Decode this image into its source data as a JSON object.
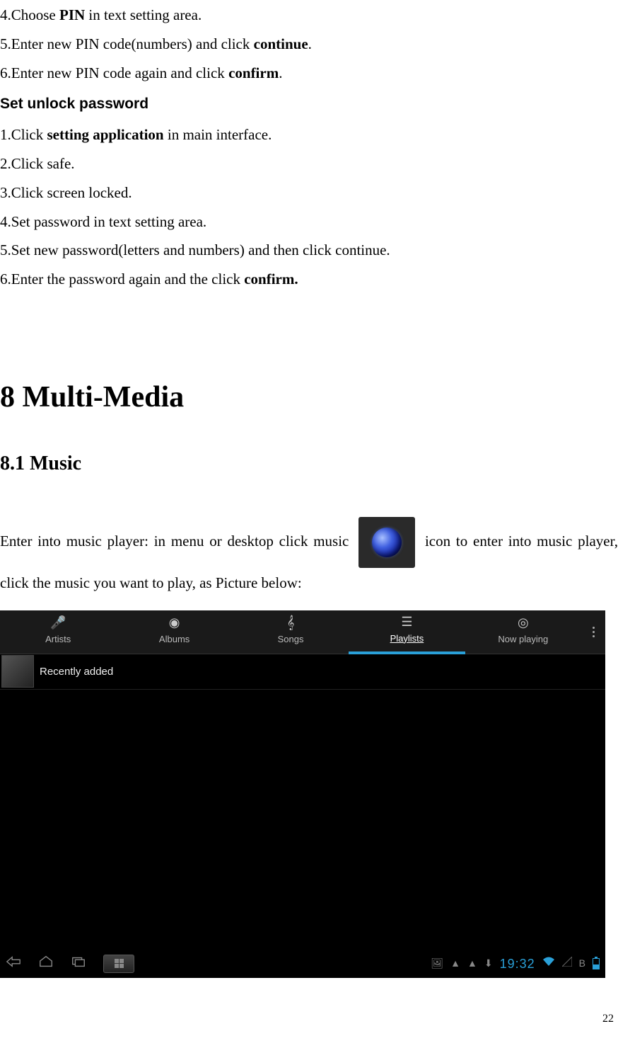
{
  "pin_steps": {
    "s4_pre": "4.Choose ",
    "s4_bold": "PIN",
    "s4_post": " in text setting area.",
    "s5_pre": "5.Enter new PIN code(numbers) and click ",
    "s5_bold": "continue",
    "s5_post": ".",
    "s6_pre": "6.Enter new PIN code again and click ",
    "s6_bold": "confirm",
    "s6_post": "."
  },
  "subheading_unlock": "Set unlock password",
  "pwd_steps": {
    "s1_pre": "1.Click ",
    "s1_bold": "setting application",
    "s1_post": " in main interface.",
    "s2": "2.Click safe.",
    "s3": "3.Click screen locked.",
    "s4": "4.Set password in text setting area.",
    "s5": "5.Set new password(letters and numbers) and then click continue.",
    "s6_pre": "6.Enter the password again and the click ",
    "s6_bold": "confirm."
  },
  "h1": "8 Multi-Media",
  "h2": "8.1 Music",
  "music_para_pre": "Enter into music player: in menu or desktop click music ",
  "music_para_post": " icon to enter into music player, click the music you want to play, as Picture below:",
  "screenshot": {
    "tabs": {
      "artists": "Artists",
      "albums": "Albums",
      "songs": "Songs",
      "playlists": "Playlists",
      "nowplaying": "Now playing"
    },
    "list_item": "Recently added",
    "clock": "19:32"
  },
  "page_number": "22"
}
